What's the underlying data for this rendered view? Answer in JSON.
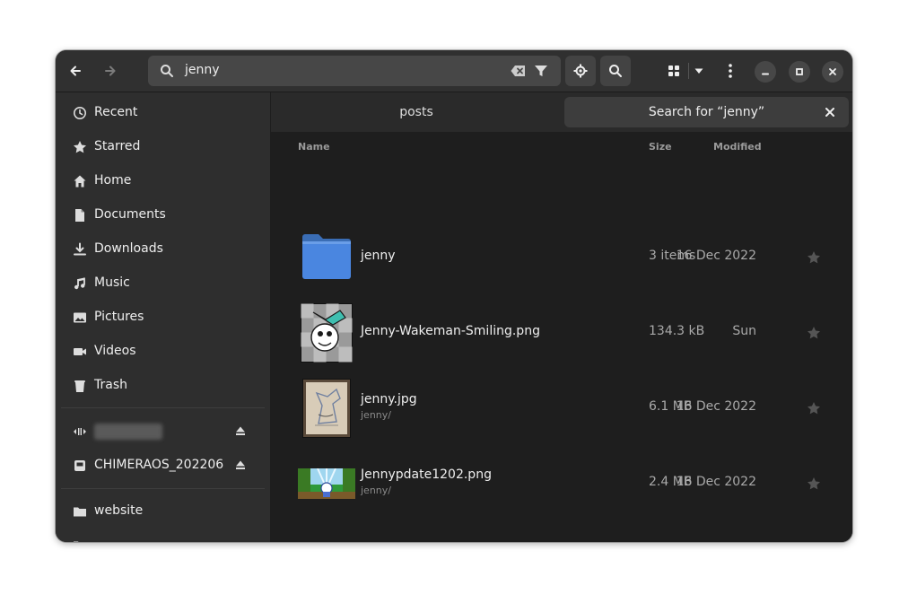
{
  "search": {
    "query": "jenny"
  },
  "sidebar": {
    "places": [
      {
        "label": "Recent",
        "icon": "clock-icon"
      },
      {
        "label": "Starred",
        "icon": "star-icon"
      },
      {
        "label": "Home",
        "icon": "home-icon"
      },
      {
        "label": "Documents",
        "icon": "document-icon"
      },
      {
        "label": "Downloads",
        "icon": "download-icon"
      },
      {
        "label": "Music",
        "icon": "music-icon"
      },
      {
        "label": "Pictures",
        "icon": "picture-icon"
      },
      {
        "label": "Videos",
        "icon": "video-icon"
      },
      {
        "label": "Trash",
        "icon": "trash-icon"
      }
    ],
    "devices": [
      {
        "label": "",
        "icon": "network-icon"
      },
      {
        "label": "CHIMERAOS_202206",
        "icon": "drive-icon"
      }
    ],
    "bookmarks": [
      {
        "label": "website",
        "icon": "folder-icon"
      }
    ]
  },
  "tabs": [
    {
      "label": "posts"
    },
    {
      "label": "Search for “jenny”"
    }
  ],
  "columns": {
    "name": "Name",
    "size": "Size",
    "modified": "Modified"
  },
  "files": [
    {
      "name": "jenny",
      "path": "",
      "size": "3 items",
      "modified": "16 Dec 2022",
      "type": "folder"
    },
    {
      "name": "Jenny-Wakeman-Smiling.png",
      "path": "",
      "size": "134.3 kB",
      "modified": "Sun",
      "type": "image"
    },
    {
      "name": "jenny.jpg",
      "path": "jenny/",
      "size": "6.1 MB",
      "modified": "16 Dec 2022",
      "type": "image"
    },
    {
      "name": "Jennypdate1202.png",
      "path": "jenny/",
      "size": "2.4 MB",
      "modified": "16 Dec 2022",
      "type": "image"
    }
  ],
  "colors": {
    "accent": "#4a86e0",
    "window_bg": "#242424",
    "sidebar_bg": "#2e2e2e",
    "main_bg": "#1e1e1e"
  }
}
